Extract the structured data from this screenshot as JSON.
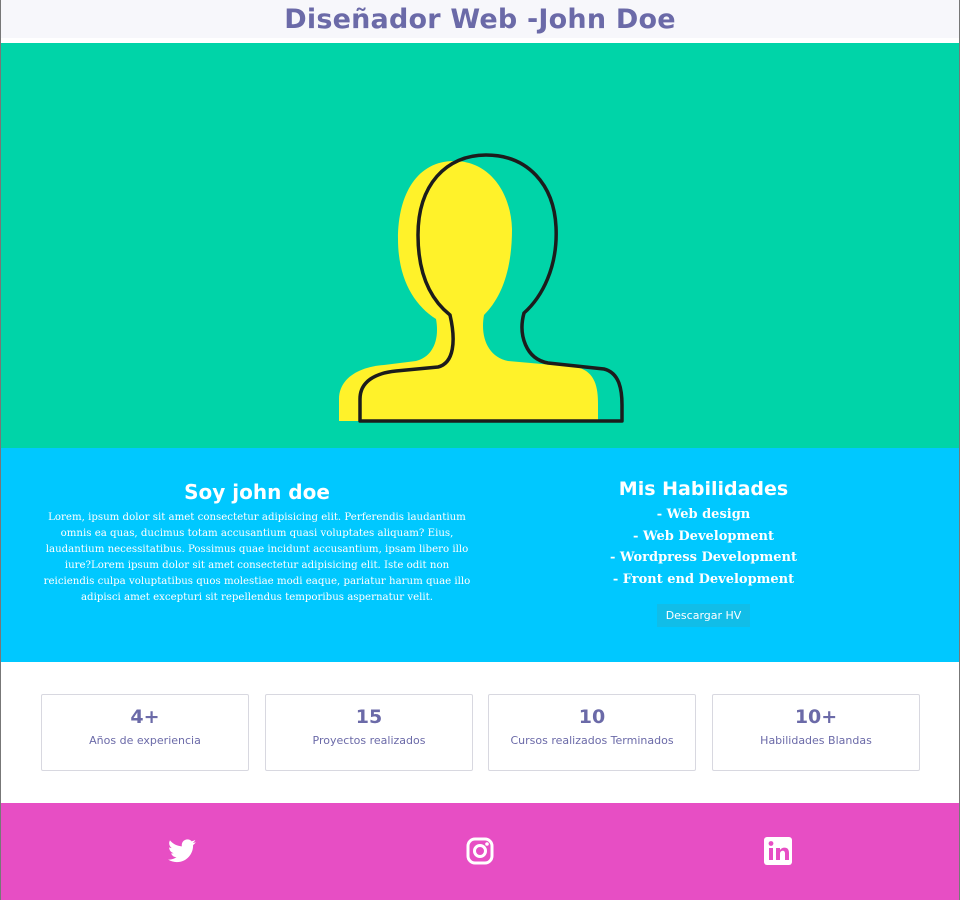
{
  "header": {
    "title": "Diseñador Web -John Doe"
  },
  "hero": {
    "avatar_icon": "user-silhouette-icon",
    "accent_color": "#fff22a",
    "bg_color": "#00d4a8"
  },
  "about": {
    "title": "Soy john doe",
    "text": "Lorem, ipsum dolor sit amet consectetur adipisicing elit. Perferendis laudantium omnis ea quas, ducimus totam accusantium quasi voluptates aliquam? Eius, laudantium necessitatibus. Possimus quae incidunt accusantium, ipsam libero illo iure?Lorem ipsum dolor sit amet consectetur adipisicing elit. Iste odit non reiciendis culpa voluptatibus quos molestiae modi eaque, pariatur harum quae illo adipisci amet excepturi sit repellendus temporibus aspernatur velit."
  },
  "skills": {
    "title": "Mis Habilidades",
    "items": [
      "- Web design",
      "- Web Development",
      "- Wordpress Development",
      "- Front end Development"
    ],
    "download_label": "Descargar HV"
  },
  "stats": [
    {
      "value": "4+",
      "label": "Años de experiencia"
    },
    {
      "value": "15",
      "label": "Proyectos realizados"
    },
    {
      "value": "10",
      "label": "Cursos realizados Terminados"
    },
    {
      "value": "10+",
      "label": "Habilidades Blandas"
    }
  ],
  "footer": {
    "social": [
      {
        "name": "twitter",
        "icon": "twitter-icon"
      },
      {
        "name": "instagram",
        "icon": "instagram-icon"
      },
      {
        "name": "linkedin",
        "icon": "linkedin-icon"
      }
    ],
    "bg_color": "#e74ec4"
  }
}
